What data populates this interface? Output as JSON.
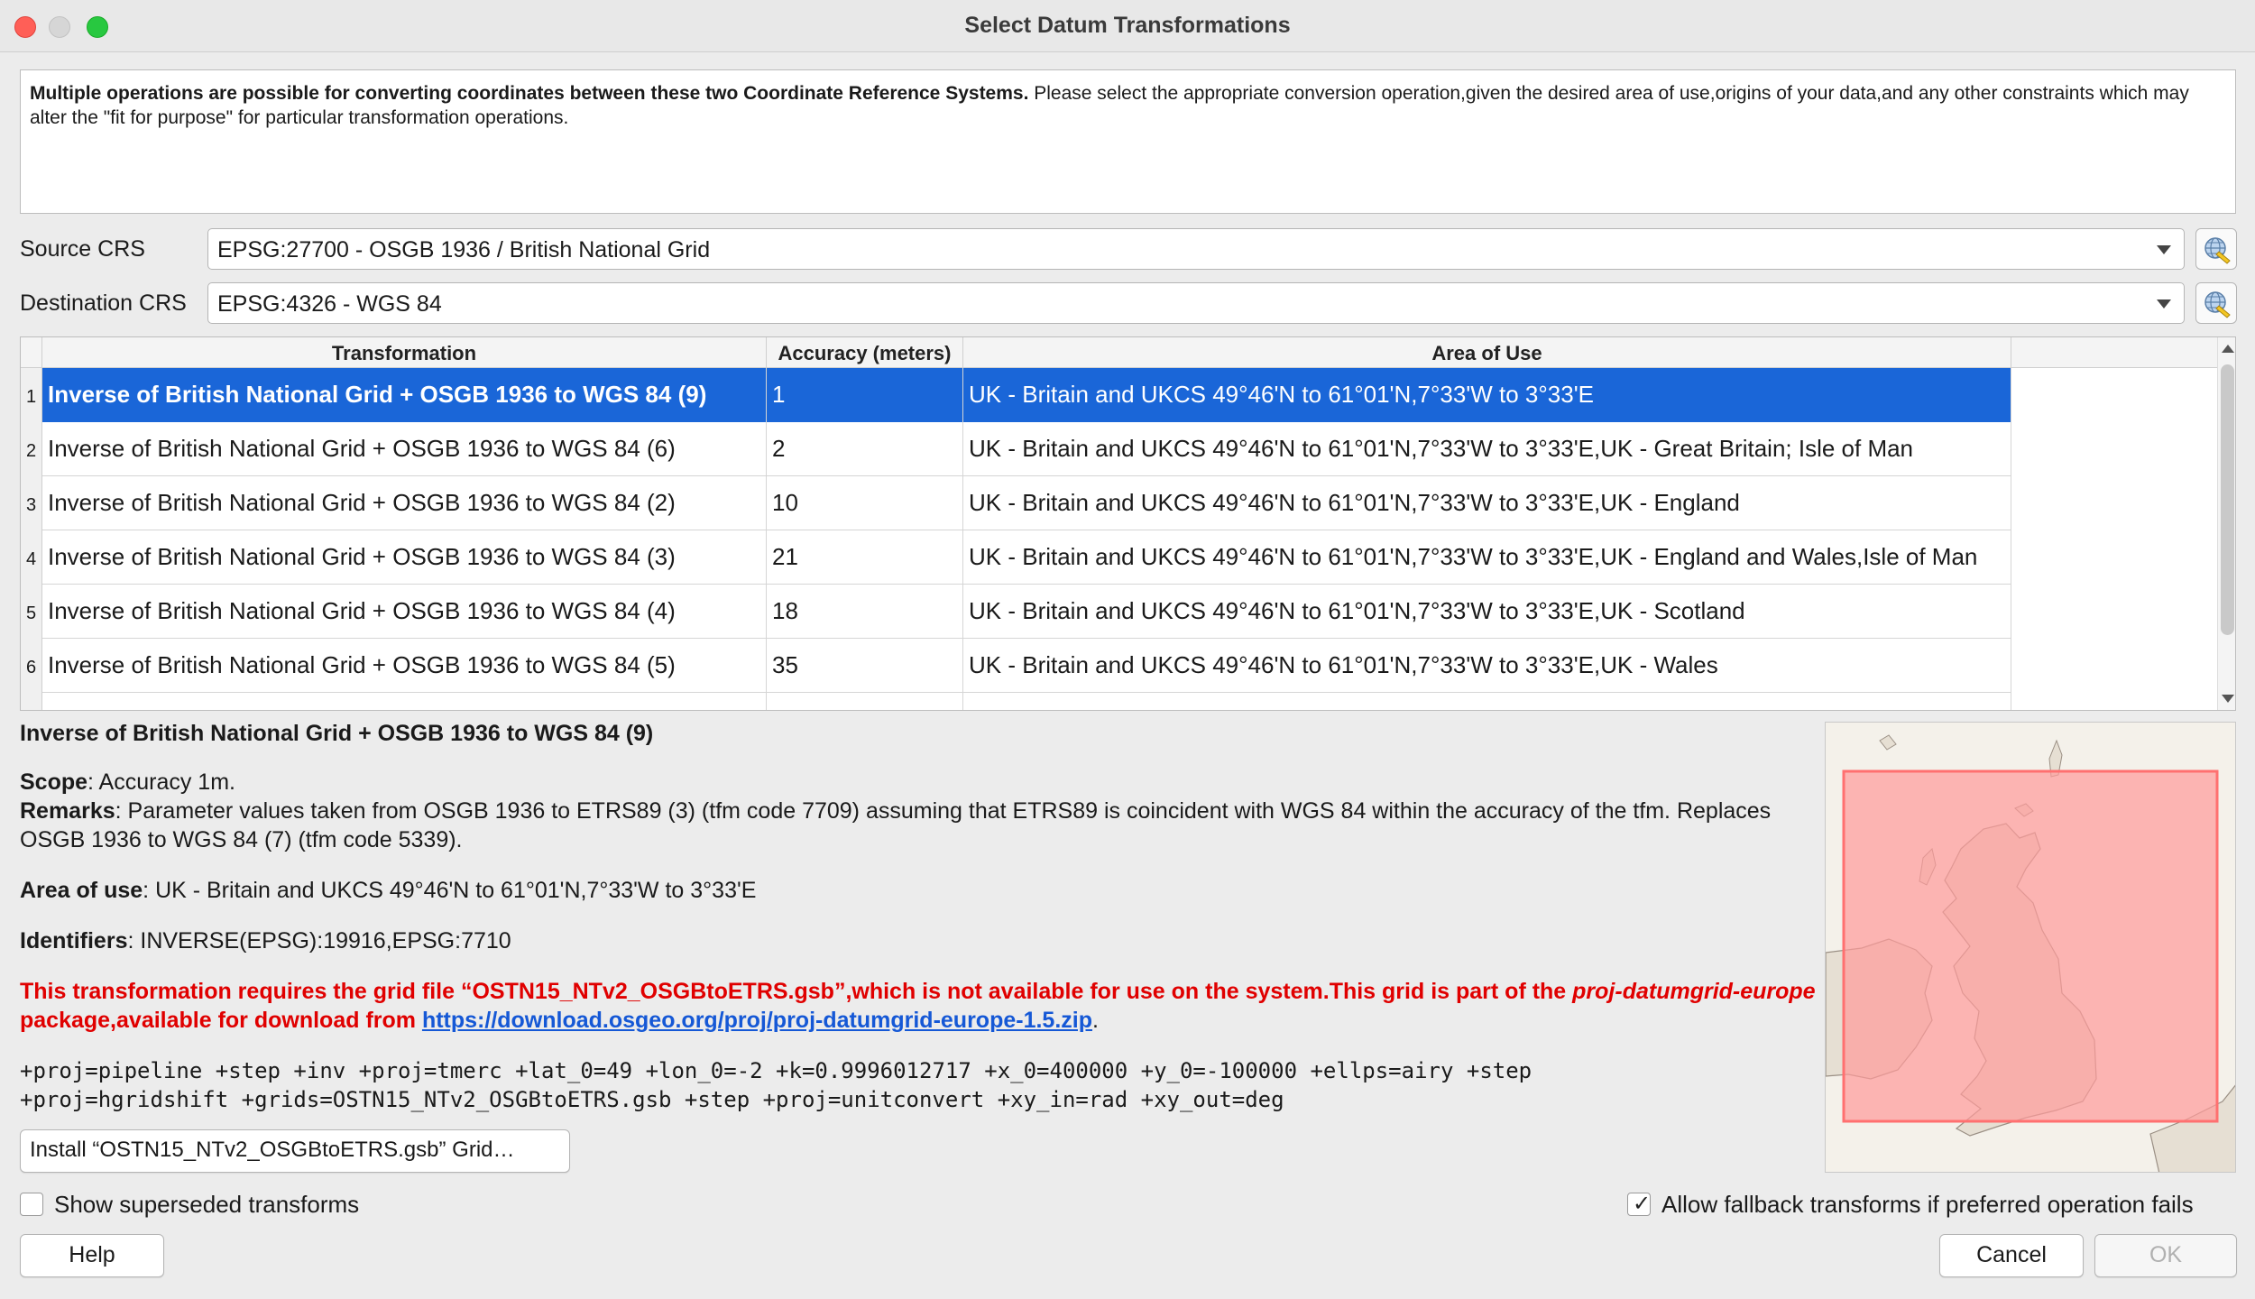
{
  "window": {
    "title": "Select Datum Transformations"
  },
  "message": {
    "bold": "Multiple operations are possible for converting coordinates between these two Coordinate Reference Systems.",
    "rest": " Please select the appropriate conversion operation,given the desired area of use,origins of your data,and any other constraints which may alter the \"fit for purpose\" for particular transformation operations."
  },
  "source_crs": {
    "label": "Source CRS",
    "value": "EPSG:27700 - OSGB 1936 / British National Grid"
  },
  "destination_crs": {
    "label": "Destination CRS",
    "value": "EPSG:4326 - WGS 84"
  },
  "table": {
    "headers": [
      "Transformation",
      "Accuracy (meters)",
      "Area of Use"
    ],
    "rows": [
      {
        "num": "1",
        "transformation": "Inverse of British National Grid + OSGB 1936 to WGS 84 (9)",
        "accuracy": "1",
        "area": "UK - Britain and UKCS 49°46'N to 61°01'N,7°33'W to 3°33'E"
      },
      {
        "num": "2",
        "transformation": "Inverse of British National Grid + OSGB 1936 to WGS 84 (6)",
        "accuracy": "2",
        "area": "UK - Britain and UKCS 49°46'N to 61°01'N,7°33'W to 3°33'E,UK - Great Britain; Isle of Man"
      },
      {
        "num": "3",
        "transformation": "Inverse of British National Grid + OSGB 1936 to WGS 84 (2)",
        "accuracy": "10",
        "area": "UK - Britain and UKCS 49°46'N to 61°01'N,7°33'W to 3°33'E,UK - England"
      },
      {
        "num": "4",
        "transformation": "Inverse of British National Grid + OSGB 1936 to WGS 84 (3)",
        "accuracy": "21",
        "area": "UK - Britain and UKCS 49°46'N to 61°01'N,7°33'W to 3°33'E,UK - England and Wales,Isle of Man"
      },
      {
        "num": "5",
        "transformation": "Inverse of British National Grid + OSGB 1936 to WGS 84 (4)",
        "accuracy": "18",
        "area": "UK - Britain and UKCS 49°46'N to 61°01'N,7°33'W to 3°33'E,UK - Scotland"
      },
      {
        "num": "6",
        "transformation": "Inverse of British National Grid + OSGB 1936 to WGS 84 (5)",
        "accuracy": "35",
        "area": "UK - Britain and UKCS 49°46'N to 61°01'N,7°33'W to 3°33'E,UK - Wales"
      }
    ]
  },
  "details": {
    "heading": "Inverse of British National Grid + OSGB 1936 to WGS 84 (9)",
    "scope_label": "Scope",
    "scope_value": ": Accuracy 1m.",
    "remarks_label": "Remarks",
    "remarks_value": ": Parameter values taken from OSGB 1936 to ETRS89 (3) (tfm code 7709) assuming that ETRS89 is coincident with WGS 84 within the accuracy of the tfm. Replaces OSGB 1936 to WGS 84 (7) (tfm code 5339).",
    "area_label": "Area of use",
    "area_value": ": UK - Britain and UKCS 49°46'N to 61°01'N,7°33'W to 3°33'E",
    "identifiers_label": "Identifiers",
    "identifiers_value": ": INVERSE(EPSG):19916,EPSG:7710",
    "warning_part1": "This transformation requires the grid file “OSTN15_NTv2_OSGBtoETRS.gsb”,which is not available for use on the system.This grid is part of the ",
    "warning_italic": "proj-datumgrid-europe",
    "warning_part2": " package,available for download from ",
    "warning_link": "https://download.osgeo.org/proj/proj-datumgrid-europe-1.5.zip",
    "warning_end": ".",
    "proj_line1": "+proj=pipeline +step +inv +proj=tmerc +lat_0=49 +lon_0=-2 +k=0.9996012717 +x_0=400000 +y_0=-100000 +ellps=airy +step",
    "proj_line2": "+proj=hgridshift +grids=OSTN15_NTv2_OSGBtoETRS.gsb +step +proj=unitconvert +xy_in=rad +xy_out=deg"
  },
  "buttons": {
    "install": "Install “OSTN15_NTv2_OSGBtoETRS.gsb” Grid…",
    "help": "Help",
    "cancel": "Cancel",
    "ok": "OK"
  },
  "checkboxes": {
    "show_superseded": {
      "label": "Show superseded transforms",
      "checked": false
    },
    "allow_fallback": {
      "label": "Allow fallback transforms if preferred operation fails",
      "checked": true
    }
  },
  "colors": {
    "selection": "#1a66d8",
    "warning": "#e00000",
    "link": "#1558d6",
    "area_fill": "#ffb3b3",
    "area_stroke": "#ff8080"
  },
  "icons": [
    "crs-selector-icon",
    "dropdown-arrow-icon",
    "scroll-up-icon",
    "scroll-down-icon",
    "checkmark-icon"
  ]
}
